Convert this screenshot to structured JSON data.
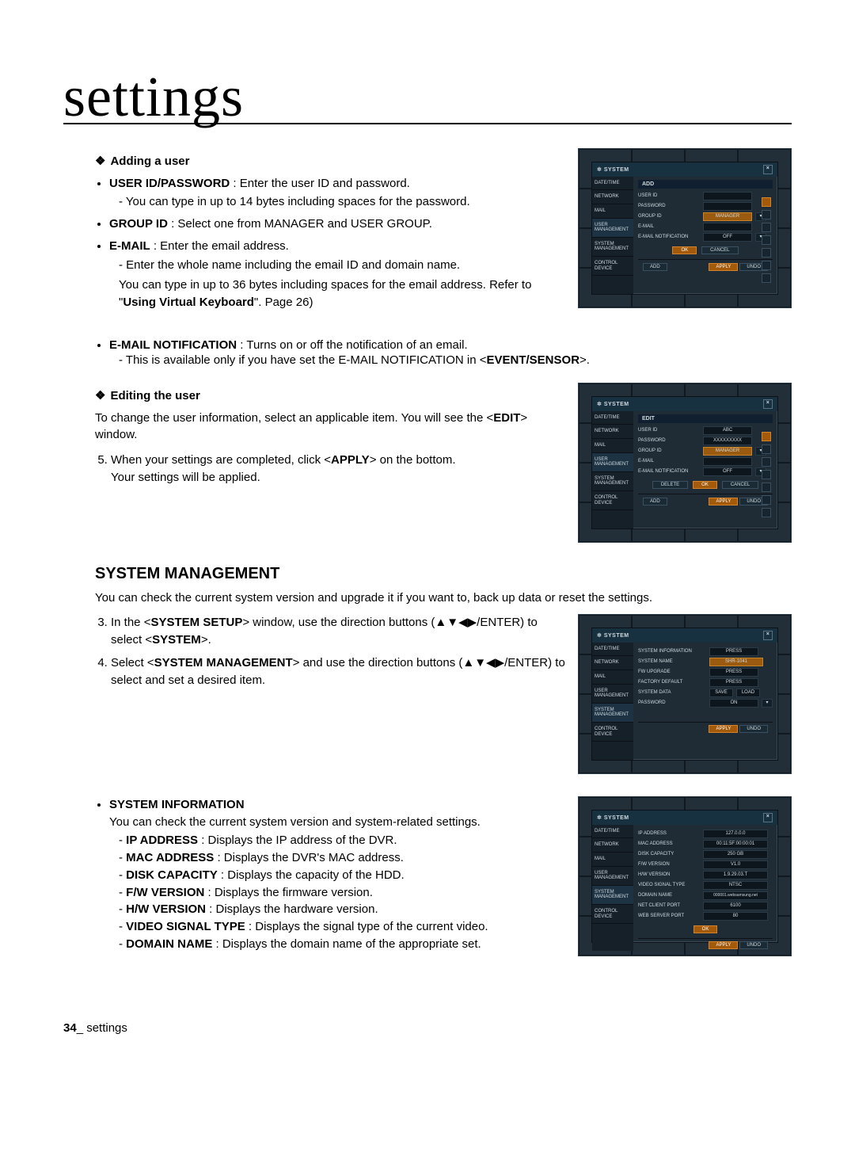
{
  "page": {
    "chapter_title": "settings",
    "footer_num": "34",
    "footer_separator": "_",
    "footer_text": "settings"
  },
  "add_user": {
    "heading": "Adding a user",
    "b1_label": "USER ID/PASSWORD",
    "b1_text": " : Enter the user ID and password.",
    "b1_sub1": "You can type in up to 14 bytes including spaces for the password.",
    "b2_label": "GROUP ID",
    "b2_text": " : Select one from MANAGER and USER GROUP.",
    "b3_label": "E-MAIL",
    "b3_text": " : Enter the email address.",
    "b3_sub1": "Enter the whole name including the email ID and domain name.",
    "b3_sub2_a": "You can type in up to 36 bytes including spaces for the email address. Refer to \"",
    "b3_sub2_b": "Using Virtual Keyboard",
    "b3_sub2_c": "\". Page 26)",
    "b4_label": "E-MAIL NOTIFICATION",
    "b4_text": " : Turns on or off the notification of an email.",
    "b4_sub1_a": "This is available only if you have set the E-MAIL NOTIFICATION in <",
    "b4_sub1_b": "EVENT/SENSOR",
    "b4_sub1_c": ">."
  },
  "edit_user": {
    "heading": "Editing the user",
    "p1_a": "To change the user information, select an applicable item. You will see the <",
    "p1_b": "EDIT",
    "p1_c": "> window.",
    "step5_a": "When your settings are completed, click <",
    "step5_b": "APPLY",
    "step5_c": "> on the bottom.",
    "step5_d": "Your settings will be applied."
  },
  "sysmgmt": {
    "heading": "SYSTEM MANAGEMENT",
    "intro": "You can check the current system version and upgrade it if you want to, back up data or reset the settings.",
    "step3_a": "In the <",
    "step3_b": "SYSTEM SETUP",
    "step3_c": "> window, use the direction buttons (▲▼◀▶/ENTER) to select <",
    "step3_d": "SYSTEM",
    "step3_e": ">.",
    "step4_a": "Select <",
    "step4_b": "SYSTEM MANAGEMENT",
    "step4_c": "> and use the direction buttons (▲▼◀▶/ENTER) to select and set a desired item.",
    "si_label": "SYSTEM INFORMATION",
    "si_text": "You can check the current system version and system-related settings.",
    "ip_l": "IP ADDRESS",
    "ip_t": " : Displays the IP address of the DVR.",
    "mac_l": "MAC ADDRESS",
    "mac_t": " : Displays the DVR's MAC address.",
    "disk_l": "DISK CAPACITY",
    "disk_t": " : Displays the capacity of the HDD.",
    "fw_l": "F/W VERSION",
    "fw_t": " : Displays the firmware version.",
    "hw_l": "H/W VERSION",
    "hw_t": " : Displays the hardware version.",
    "vst_l": "VIDEO SIGNAL TYPE",
    "vst_t": " : Displays the signal type of the current video.",
    "dn_l": "DOMAIN NAME",
    "dn_t": " : Displays the domain name of the appropriate set."
  },
  "dvr_common": {
    "title": "SYSTEM",
    "tabs": [
      "DATE/TIME",
      "NETWORK",
      "MAIL",
      "USER MANAGEMENT",
      "SYSTEM MANAGEMENT",
      "CONTROL DEVICE"
    ],
    "add_btn": "ADD",
    "apply": "APPLY",
    "undo": "UNDO",
    "ok": "OK",
    "cancel": "CANCEL",
    "delete": "DELETE"
  },
  "dvr1": {
    "subtitle": "ADD",
    "rows": {
      "uid": "USER ID",
      "pwd": "PASSWORD",
      "gid": "GROUP ID",
      "gid_val": "MANAGER",
      "email": "E-MAIL",
      "notif": "E-MAIL NOTIFICATION",
      "notif_val": "OFF"
    }
  },
  "dvr2": {
    "subtitle": "EDIT",
    "rows": {
      "uid": "USER ID",
      "uid_val": "ABC",
      "pwd": "PASSWORD",
      "pwd_val": "XXXXXXXXX",
      "gid": "GROUP ID",
      "gid_val": "MANAGER",
      "email": "E-MAIL",
      "notif": "E-MAIL NOTIFICATION",
      "notif_val": "OFF"
    }
  },
  "dvr3": {
    "rows": {
      "sysinfo": "SYSTEM INFORMATION",
      "sysinfo_btn": "PRESS",
      "sysname": "SYSTEM NAME",
      "sysname_val": "SHR-1041",
      "fwu": "FW UPGRADE",
      "fwu_btn": "PRESS",
      "fd": "FACTORY DEFAULT",
      "fd_btn": "PRESS",
      "sd": "SYSTEM DATA",
      "sd_save": "SAVE",
      "sd_load": "LOAD",
      "pw": "PASSWORD",
      "pw_val": "ON"
    }
  },
  "dvr4": {
    "rows": {
      "ip": "IP ADDRESS",
      "ip_v": "127.0.0.0",
      "mac": "MAC ADDRESS",
      "mac_v": "00:11:5F:00:00:01",
      "disk": "DISK CAPACITY",
      "disk_v": "250 GB",
      "fw": "F/W VERSION",
      "fw_v": "V1.0",
      "hw": "H/W VERSION",
      "hw_v": "1.9.29.03.T",
      "vst": "VIDEO SIGNAL TYPE",
      "vst_v": "NTSC",
      "dn": "DOMAIN NAME",
      "dn_v": "000001.websamsung.net",
      "ncp": "NET CLIENT PORT",
      "ncp_v": "6100",
      "wsp": "WEB SERVER PORT",
      "wsp_v": "80"
    }
  }
}
